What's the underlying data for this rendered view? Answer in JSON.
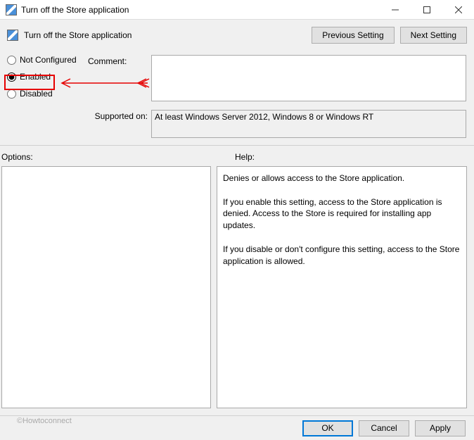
{
  "window": {
    "title": "Turn off the Store application"
  },
  "header": {
    "policy_title": "Turn off the Store application",
    "prev_btn": "Previous Setting",
    "next_btn": "Next Setting"
  },
  "radios": {
    "not_configured": "Not Configured",
    "enabled": "Enabled",
    "disabled": "Disabled",
    "selected": "enabled"
  },
  "labels": {
    "comment": "Comment:",
    "supported": "Supported on:",
    "options": "Options:",
    "help": "Help:"
  },
  "supported_text": "At least Windows Server 2012, Windows 8 or Windows RT",
  "help_text": "Denies or allows access to the Store application.\n\nIf you enable this setting, access to the Store application is denied. Access to the Store is required for installing app updates.\n\nIf you disable or don't configure this setting, access to the Store application is allowed.",
  "buttons": {
    "ok": "OK",
    "cancel": "Cancel",
    "apply": "Apply"
  },
  "watermark": "©Howtoconnect"
}
